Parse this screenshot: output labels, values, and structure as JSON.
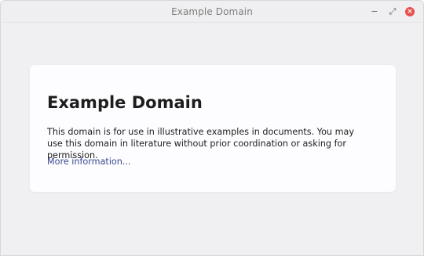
{
  "window": {
    "title": "Example Domain",
    "controls": {
      "minimize_icon": "−",
      "maximize_icon": "⤢",
      "close_icon": "×"
    },
    "colors": {
      "close_button": "#e94f4f",
      "titlebar": "#efeff1",
      "background": "#f0f0f2"
    }
  },
  "page": {
    "heading": "Example Domain",
    "paragraph": "This domain is for use in illustrative examples in documents. You may use this domain in literature without prior coordination or asking for permission.",
    "link_text": "More information...",
    "colors": {
      "link": "#38488f",
      "card": "#fdfdff"
    }
  }
}
